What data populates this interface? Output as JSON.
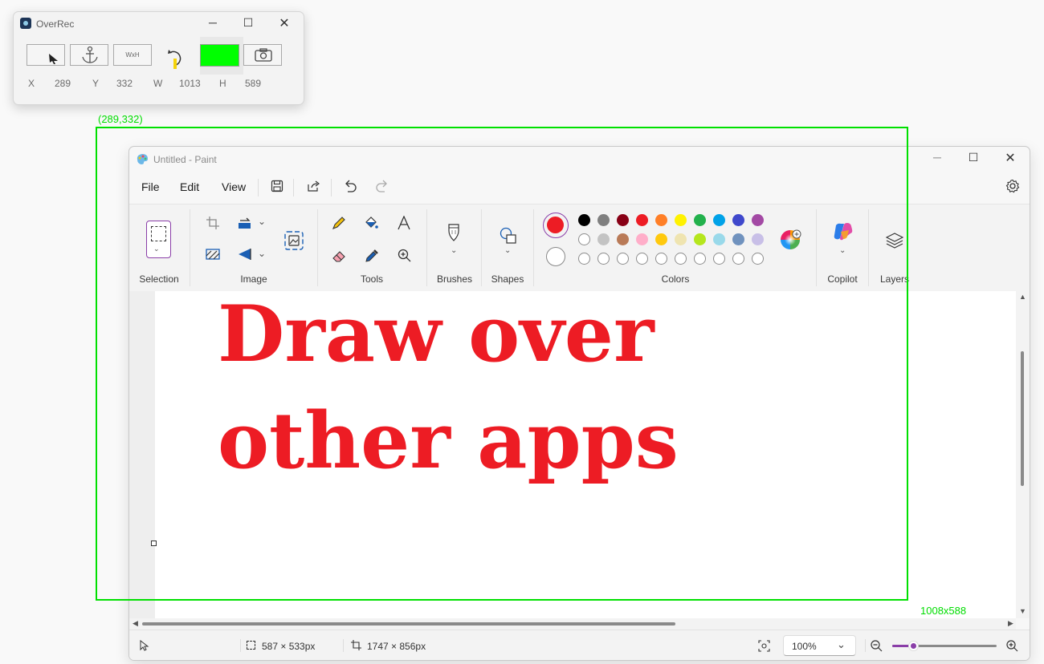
{
  "overrec": {
    "title": "OverRec",
    "size_button_label": "WxH",
    "coords": [
      {
        "label": "X",
        "value": "289"
      },
      {
        "label": "Y",
        "value": "332"
      },
      {
        "label": "W",
        "value": "1013"
      },
      {
        "label": "H",
        "value": "589"
      }
    ],
    "color_swatch": "#00ff00"
  },
  "capture": {
    "origin_label": "(289,332)",
    "size_label": "1008x588",
    "color": "#00e000"
  },
  "paint": {
    "title": "Untitled - Paint",
    "menu": [
      "File",
      "Edit",
      "View"
    ],
    "groups": {
      "selection": "Selection",
      "image": "Image",
      "tools": "Tools",
      "brushes": "Brushes",
      "shapes": "Shapes",
      "colors": "Colors",
      "copilot": "Copilot",
      "layers": "Layers"
    },
    "primary_color": "#ed1c24",
    "secondary_color": "#ffffff",
    "palette_row1": [
      "#000000",
      "#7f7f7f",
      "#880015",
      "#ed1c24",
      "#ff7f27",
      "#fff200",
      "#22b14c",
      "#00a2e8",
      "#3f48cc",
      "#a349a4"
    ],
    "palette_row2": [
      "#ffffff",
      "#c3c3c3",
      "#b97a57",
      "#ffaec9",
      "#ffc90e",
      "#efe4b0",
      "#b5e61d",
      "#99d9ea",
      "#7092be",
      "#c8bfe7"
    ],
    "canvas_text_line1": "Draw over",
    "canvas_text_line2": "other apps",
    "status": {
      "selection_size": "587 × 533px",
      "canvas_size": "1747 × 856px",
      "zoom": "100%",
      "zoom_fraction": 0.2
    }
  }
}
